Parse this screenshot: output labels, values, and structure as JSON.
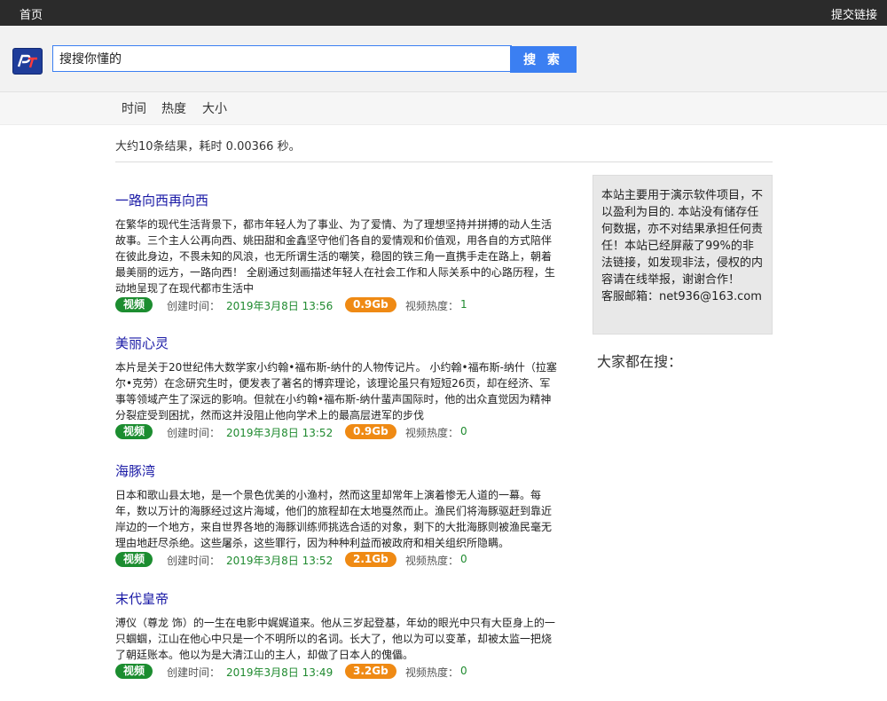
{
  "topbar": {
    "home": "首页",
    "submit": "提交链接"
  },
  "search": {
    "value": "搜搜你懂的",
    "button": "搜 索"
  },
  "sort": {
    "time": "时间",
    "popularity": "热度",
    "size": "大小"
  },
  "summary": "大约10条结果，耗时 0.00366 秒。",
  "results": [
    {
      "title": "一路向西再向西",
      "desc": "在繁华的现代生活背景下，都市年轻人为了事业、为了爱情、为了理想坚持并拼搏的动人生活故事。三个主人公再向西、姚田甜和金鑫坚守他们各自的爱情观和价值观，用各自的方式陪伴在彼此身边，不畏未知的风浪，也无所谓生活的嘲笑，稳固的铁三角一直携手走在路上，朝着最美丽的远方，一路向西！ 全剧通过刻画描述年轻人在社会工作和人际关系中的心路历程，生动地呈现了在现代都市生活中",
      "type": "视频",
      "created_label": "创建时间：",
      "created": "2019年3月8日 13:56",
      "size": "0.9Gb",
      "heat_label": "视频热度：",
      "heat": "1"
    },
    {
      "title": "美丽心灵",
      "desc": "本片是关于20世纪伟大数学家小约翰•福布斯-纳什的人物传记片。        小约翰•福布斯-纳什（拉塞尔•克劳）在念研究生时，便发表了著名的博弈理论，该理论虽只有短短26页，却在经济、军事等领域产生了深远的影响。但就在小约翰•福布斯-纳什蜚声国际时，他的出众直觉因为精神分裂症受到困扰，然而这并没阻止他向学术上的最高层进军的步伐",
      "type": "视频",
      "created_label": "创建时间：",
      "created": "2019年3月8日 13:52",
      "size": "0.9Gb",
      "heat_label": "视频热度：",
      "heat": "0"
    },
    {
      "title": "海豚湾",
      "desc": "日本和歌山县太地，是一个景色优美的小渔村，然而这里却常年上演着惨无人道的一幕。每年，数以万计的海豚经过这片海域，他们的旅程却在太地戛然而止。渔民们将海豚驱赶到靠近岸边的一个地方，来自世界各地的海豚训练师挑选合适的对象，剩下的大批海豚则被渔民毫无理由地赶尽杀绝。这些屠杀，这些罪行，因为种种利益而被政府和相关组织所隐瞒。",
      "type": "视频",
      "created_label": "创建时间：",
      "created": "2019年3月8日 13:52",
      "size": "2.1Gb",
      "heat_label": "视频热度：",
      "heat": "0"
    },
    {
      "title": "末代皇帝",
      "desc": "溥仪（尊龙 饰）的一生在电影中娓娓道来。他从三岁起登基，年幼的眼光中只有大臣身上的一只蝈蝈，江山在他心中只是一个不明所以的名词。长大了，他以为可以变革，却被太监一把烧了朝廷账本。他以为是大清江山的主人，却做了日本人的傀儡。",
      "type": "视频",
      "created_label": "创建时间：",
      "created": "2019年3月8日 13:49",
      "size": "3.2Gb",
      "heat_label": "视频热度：",
      "heat": "0"
    }
  ],
  "sidebar": {
    "notice": "本站主要用于演示软件项目，不以盈利为目的. 本站没有储存任何数据，亦不对结果承担任何责任！本站已经屏蔽了99%的非法链接，如发现非法，侵权的内容请在线举报，谢谢合作！",
    "email": "客服邮箱：net936@163.com",
    "trending_title": "大家都在搜："
  },
  "colors": {
    "accent": "#3b7ff2",
    "video_badge": "#1c8d30",
    "size_badge": "#ef8a14",
    "link": "#1a1aa6"
  },
  "icons": {
    "logo": "site-logo-icon"
  }
}
